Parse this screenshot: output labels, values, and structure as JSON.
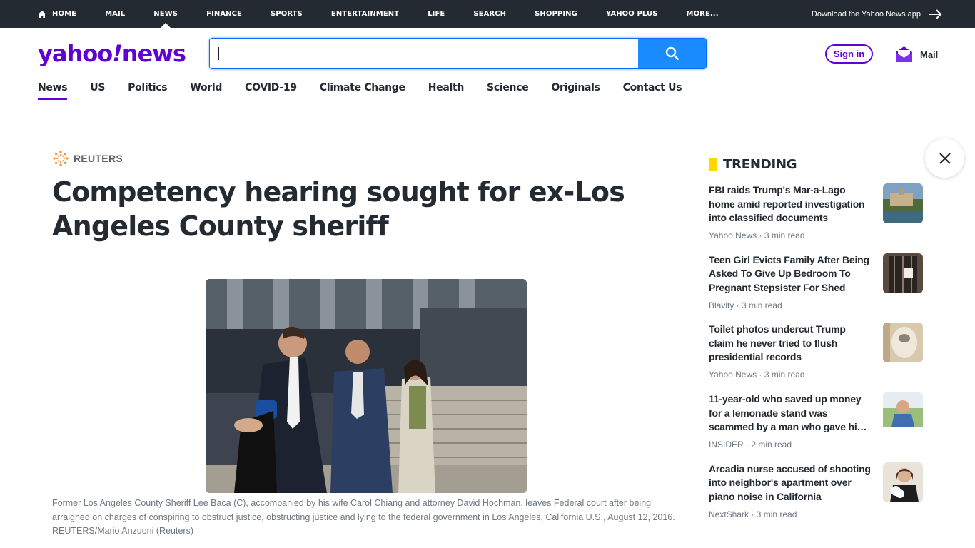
{
  "topnav": {
    "items": [
      {
        "label": "HOME"
      },
      {
        "label": "MAIL"
      },
      {
        "label": "NEWS"
      },
      {
        "label": "FINANCE"
      },
      {
        "label": "SPORTS"
      },
      {
        "label": "ENTERTAINMENT"
      },
      {
        "label": "LIFE"
      },
      {
        "label": "SEARCH"
      },
      {
        "label": "SHOPPING"
      },
      {
        "label": "YAHOO PLUS"
      },
      {
        "label": "MORE..."
      }
    ],
    "download_label": "Download the Yahoo News app"
  },
  "header": {
    "logo_main": "yahoo",
    "logo_bang": "!",
    "logo_sub": "news",
    "search_value": "",
    "signin_label": "Sign in",
    "mail_label": "Mail"
  },
  "subnav": {
    "items": [
      {
        "label": "News"
      },
      {
        "label": "US"
      },
      {
        "label": "Politics"
      },
      {
        "label": "World"
      },
      {
        "label": "COVID-19"
      },
      {
        "label": "Climate Change"
      },
      {
        "label": "Health"
      },
      {
        "label": "Science"
      },
      {
        "label": "Originals"
      },
      {
        "label": "Contact Us"
      }
    ]
  },
  "article": {
    "provider": "REUTERS",
    "headline": "Competency hearing sought for ex-Los Angeles County sheriff",
    "caption": "Former Los Angeles County Sheriff Lee Baca (C), accompanied by his wife Carol Chiang and attorney David Hochman, leaves Federal court after being arraigned on charges of conspiring to obstruct justice, obstructing justice and lying to the federal government in Los Angeles, California U.S., August 12, 2016. REUTERS/Mario Anzuoni (Reuters)"
  },
  "trending": {
    "heading": "TRENDING",
    "items": [
      {
        "title": "FBI raids Trump's Mar-a-Lago home amid reported investigation into classified documents",
        "meta": "Yahoo News · 3 min read"
      },
      {
        "title": "Teen Girl Evicts Family After Being Asked To Give Up Bedroom To Pregnant Stepsister For Shed",
        "meta": "Blavity · 3 min read"
      },
      {
        "title": "Toilet photos undercut Trump claim he never tried to flush presidential records",
        "meta": "Yahoo News · 3 min read"
      },
      {
        "title": "11-year-old who saved up money for a lemonade stand was scammed by a man who gave hi…",
        "meta": "INSIDER · 2 min read"
      },
      {
        "title": "Arcadia nurse accused of shooting into neighbor's apartment over piano noise in California",
        "meta": "NextShark · 3 min read"
      }
    ]
  },
  "colors": {
    "topbar": "#232a31",
    "brand_purple": "#6001d2",
    "search_blue": "#1a8cff",
    "trending_yellow": "#ffd800"
  }
}
